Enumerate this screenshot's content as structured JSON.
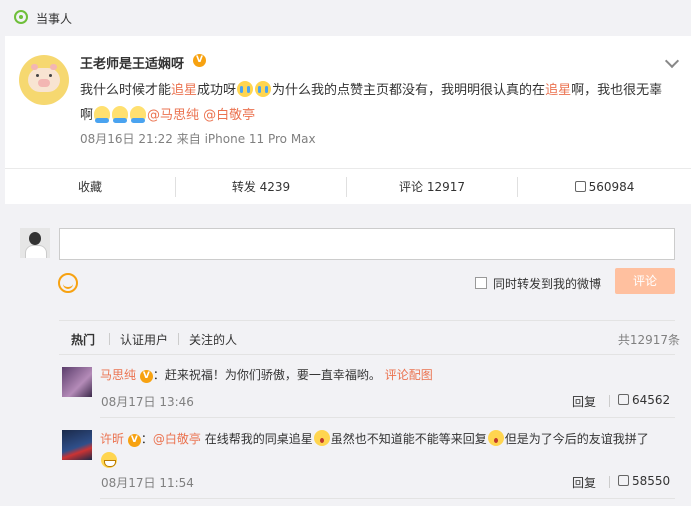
{
  "topbar": {
    "label": "当事人"
  },
  "post": {
    "author": "王老师是王适娴呀",
    "verified_badge": "V",
    "text_segments": [
      {
        "t": "我什么时候才能",
        "k": "plain"
      },
      {
        "t": "追星",
        "k": "hl"
      },
      {
        "t": "成功呀",
        "k": "plain"
      },
      {
        "t": "",
        "k": "emoji-cry"
      },
      {
        "t": "",
        "k": "emoji-cry"
      },
      {
        "t": "为什么我的点赞主页都没有，我明明很认真的在",
        "k": "plain"
      },
      {
        "t": "追星",
        "k": "hl"
      },
      {
        "t": "啊，我也很无辜啊",
        "k": "plain"
      },
      {
        "t": "",
        "k": "emoji-hug"
      },
      {
        "t": "",
        "k": "emoji-hug"
      },
      {
        "t": "",
        "k": "emoji-hug"
      },
      {
        "t": "@马思纯",
        "k": "mention"
      },
      {
        "t": " ",
        "k": "plain"
      },
      {
        "t": "@白敬亭",
        "k": "mention"
      }
    ],
    "meta": "08月16日 21:22  来自 iPhone 11 Pro Max"
  },
  "actions": {
    "favorite": "收藏",
    "repost": "转发 4239",
    "comment": "评论 12917",
    "like": "560984"
  },
  "compose": {
    "placeholder": "",
    "repost_label": "同时转发到我的微博",
    "submit": "评论"
  },
  "tabs": {
    "hot": "热门",
    "verified": "认证用户",
    "following": "关注的人",
    "total": "共12917条"
  },
  "comments": [
    {
      "name": "马思纯",
      "badge": "V",
      "text": "：赶来祝福！为你们骄傲，要一直幸福哟。",
      "extra": "评论配图",
      "time": "08月17日 13:46",
      "reply": "回复",
      "likes": "64562"
    },
    {
      "name": "许昕",
      "badge": "V",
      "mention": "@白敬亭",
      "text_a": "在线帮我的同桌追星",
      "text_b": "虽然也不知道能不能等来回复",
      "text_c": "但是为了今后的友谊我拼了",
      "time": "08月17日 11:54",
      "reply": "回复",
      "likes": "58550"
    }
  ],
  "colors": {
    "accent": "#eb7350",
    "badge": "#f7a211",
    "submit_disabled": "#ffc09f",
    "tag_green": "#6fbf3a"
  }
}
